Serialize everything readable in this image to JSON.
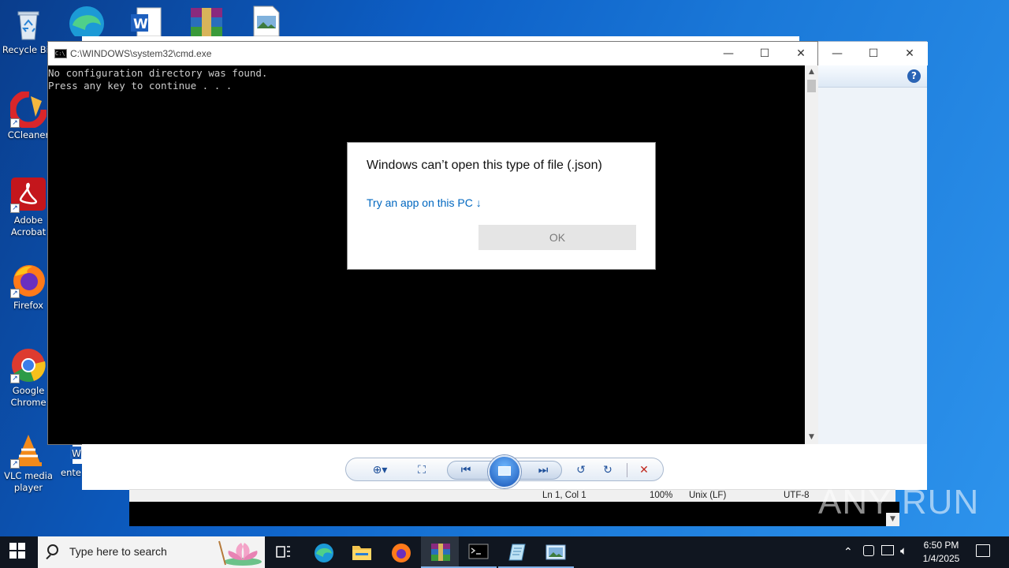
{
  "desktop": {
    "icons": [
      {
        "label": "Recycle Bin",
        "icon": "recycle-bin-icon"
      },
      {
        "label": "CCleaner",
        "icon": "ccleaner-icon"
      },
      {
        "label": "Adobe Acrobat",
        "icon": "acrobat-icon"
      },
      {
        "label": "Firefox",
        "icon": "firefox-icon"
      },
      {
        "label": "Google Chrome",
        "icon": "chrome-icon"
      },
      {
        "label": "VLC media player",
        "icon": "vlc-icon"
      },
      {
        "label": "ente",
        "icon": "word-doc-icon"
      }
    ],
    "top_icons": [
      "edge-icon",
      "word-icon",
      "winrar-icon",
      "image-file-icon"
    ]
  },
  "cmd": {
    "title": "C:\\WINDOWS\\system32\\cmd.exe",
    "lines": [
      "No configuration directory was found.",
      "Press any key to continue . . ."
    ]
  },
  "dialog": {
    "title": "Windows can’t open this type of file (.json)",
    "link": "Try an app on this PC ↓",
    "ok": "OK"
  },
  "notepad_status": {
    "position": "Ln 1, Col 1",
    "zoom": "100%",
    "line_ending": "Unix (LF)",
    "encoding": "UTF-8"
  },
  "taskbar": {
    "search_placeholder": "Type here to search",
    "time": "6:50 PM",
    "date": "1/4/2025"
  },
  "watermark": "ANY RUN"
}
